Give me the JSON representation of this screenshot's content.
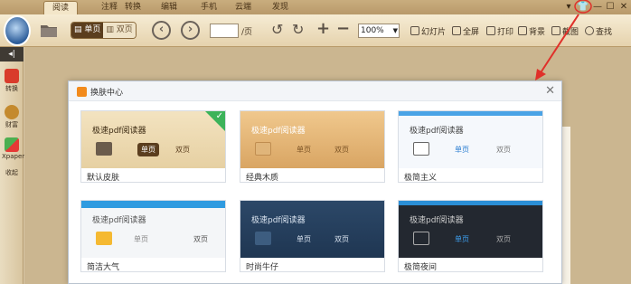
{
  "tabs": [
    "阅读",
    "注释",
    "转换",
    "编辑",
    "手机",
    "云端",
    "发现"
  ],
  "active_tab": 0,
  "window_controls": [
    "▾",
    "👕",
    "—",
    "☐",
    "✕"
  ],
  "toolbar": {
    "single_page": "单页",
    "double_page": "双页",
    "page_suffix": "/页",
    "zoom_value": "100%",
    "buttons": [
      "幻灯片",
      "全屏",
      "打印",
      "背景",
      "截图",
      "查找"
    ]
  },
  "sidebar": {
    "top_glyph": "◂|",
    "items": [
      "转换",
      "财富",
      "Xpaper",
      "收起"
    ]
  },
  "dialog": {
    "title": "换肤中心",
    "close": "✕",
    "app_name": "极速pdf阅读器",
    "skins": [
      {
        "name": "默认皮肤",
        "single": "单页",
        "double": "双页",
        "selected": true
      },
      {
        "name": "经典木质",
        "single": "单页",
        "double": "双页",
        "selected": false
      },
      {
        "name": "极简主义",
        "single": "单页",
        "double": "双页",
        "selected": false
      },
      {
        "name": "简洁大气",
        "single": "单页",
        "double": "双页",
        "selected": false
      },
      {
        "name": "时尚牛仔",
        "single": "单页",
        "double": "双页",
        "selected": false
      },
      {
        "name": "极简夜间",
        "single": "单页",
        "double": "双页",
        "selected": false
      }
    ]
  },
  "colors": {
    "accent_orange": "#f28a1b",
    "selected_check": "#3cb35a",
    "annotation_red": "#e0302a"
  }
}
